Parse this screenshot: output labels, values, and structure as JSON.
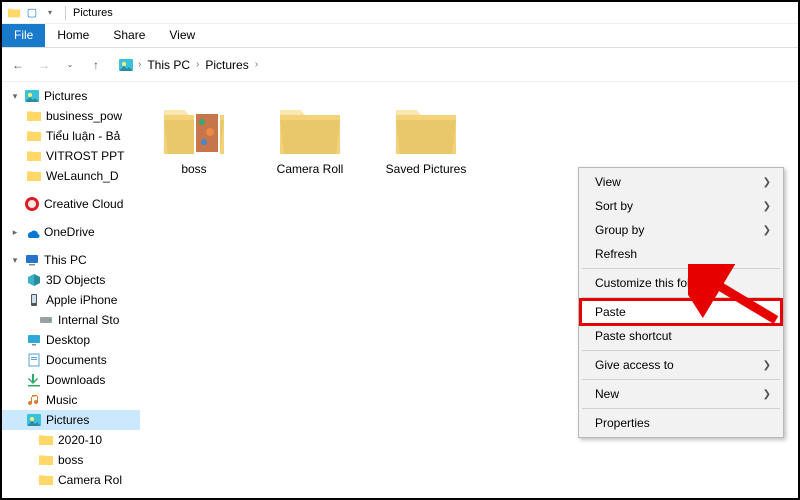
{
  "window": {
    "title": "Pictures"
  },
  "ribbon": {
    "file": "File",
    "tabs": [
      "Home",
      "Share",
      "View"
    ]
  },
  "breadcrumb": {
    "parts": [
      "This PC",
      "Pictures"
    ]
  },
  "sidebar": {
    "groups": [
      {
        "label": "Pictures",
        "icon": "pictures",
        "expander": "▾",
        "children": [
          {
            "label": "business_pow",
            "icon": "folder"
          },
          {
            "label": "Tiểu luận - Bả",
            "icon": "folder"
          },
          {
            "label": "VITROST PPT",
            "icon": "folder"
          },
          {
            "label": "WeLaunch_D",
            "icon": "folder"
          }
        ]
      },
      {
        "label": "Creative Cloud",
        "icon": "cc",
        "solo": true
      },
      {
        "label": "OneDrive",
        "icon": "onedrive",
        "expander": "▸",
        "solo": true
      },
      {
        "label": "This PC",
        "icon": "thispc",
        "expander": "▾",
        "children": [
          {
            "label": "3D Objects",
            "icon": "3d"
          },
          {
            "label": "Apple iPhone",
            "icon": "phone"
          },
          {
            "label": "Internal Sto",
            "icon": "drive",
            "indent": true
          },
          {
            "label": "Desktop",
            "icon": "desktop"
          },
          {
            "label": "Documents",
            "icon": "documents"
          },
          {
            "label": "Downloads",
            "icon": "downloads"
          },
          {
            "label": "Music",
            "icon": "music"
          },
          {
            "label": "Pictures",
            "icon": "pictures",
            "selected": true
          },
          {
            "label": "2020-10",
            "icon": "folder",
            "indent": true
          },
          {
            "label": "boss",
            "icon": "folder",
            "indent": true
          },
          {
            "label": "Camera Rol",
            "icon": "folder",
            "indent": true
          }
        ]
      }
    ]
  },
  "items": [
    {
      "label": "boss",
      "variant": "preview"
    },
    {
      "label": "Camera Roll",
      "variant": "plain"
    },
    {
      "label": "Saved Pictures",
      "variant": "plain"
    }
  ],
  "context": {
    "groups": [
      [
        {
          "label": "View",
          "arrow": true
        },
        {
          "label": "Sort by",
          "arrow": true
        },
        {
          "label": "Group by",
          "arrow": true
        },
        {
          "label": "Refresh"
        }
      ],
      [
        {
          "label": "Customize this folder..."
        }
      ],
      [
        {
          "label": "Paste",
          "highlight": true
        },
        {
          "label": "Paste shortcut"
        }
      ],
      [
        {
          "label": "Give access to",
          "arrow": true
        }
      ],
      [
        {
          "label": "New",
          "arrow": true
        }
      ],
      [
        {
          "label": "Properties"
        }
      ]
    ]
  }
}
